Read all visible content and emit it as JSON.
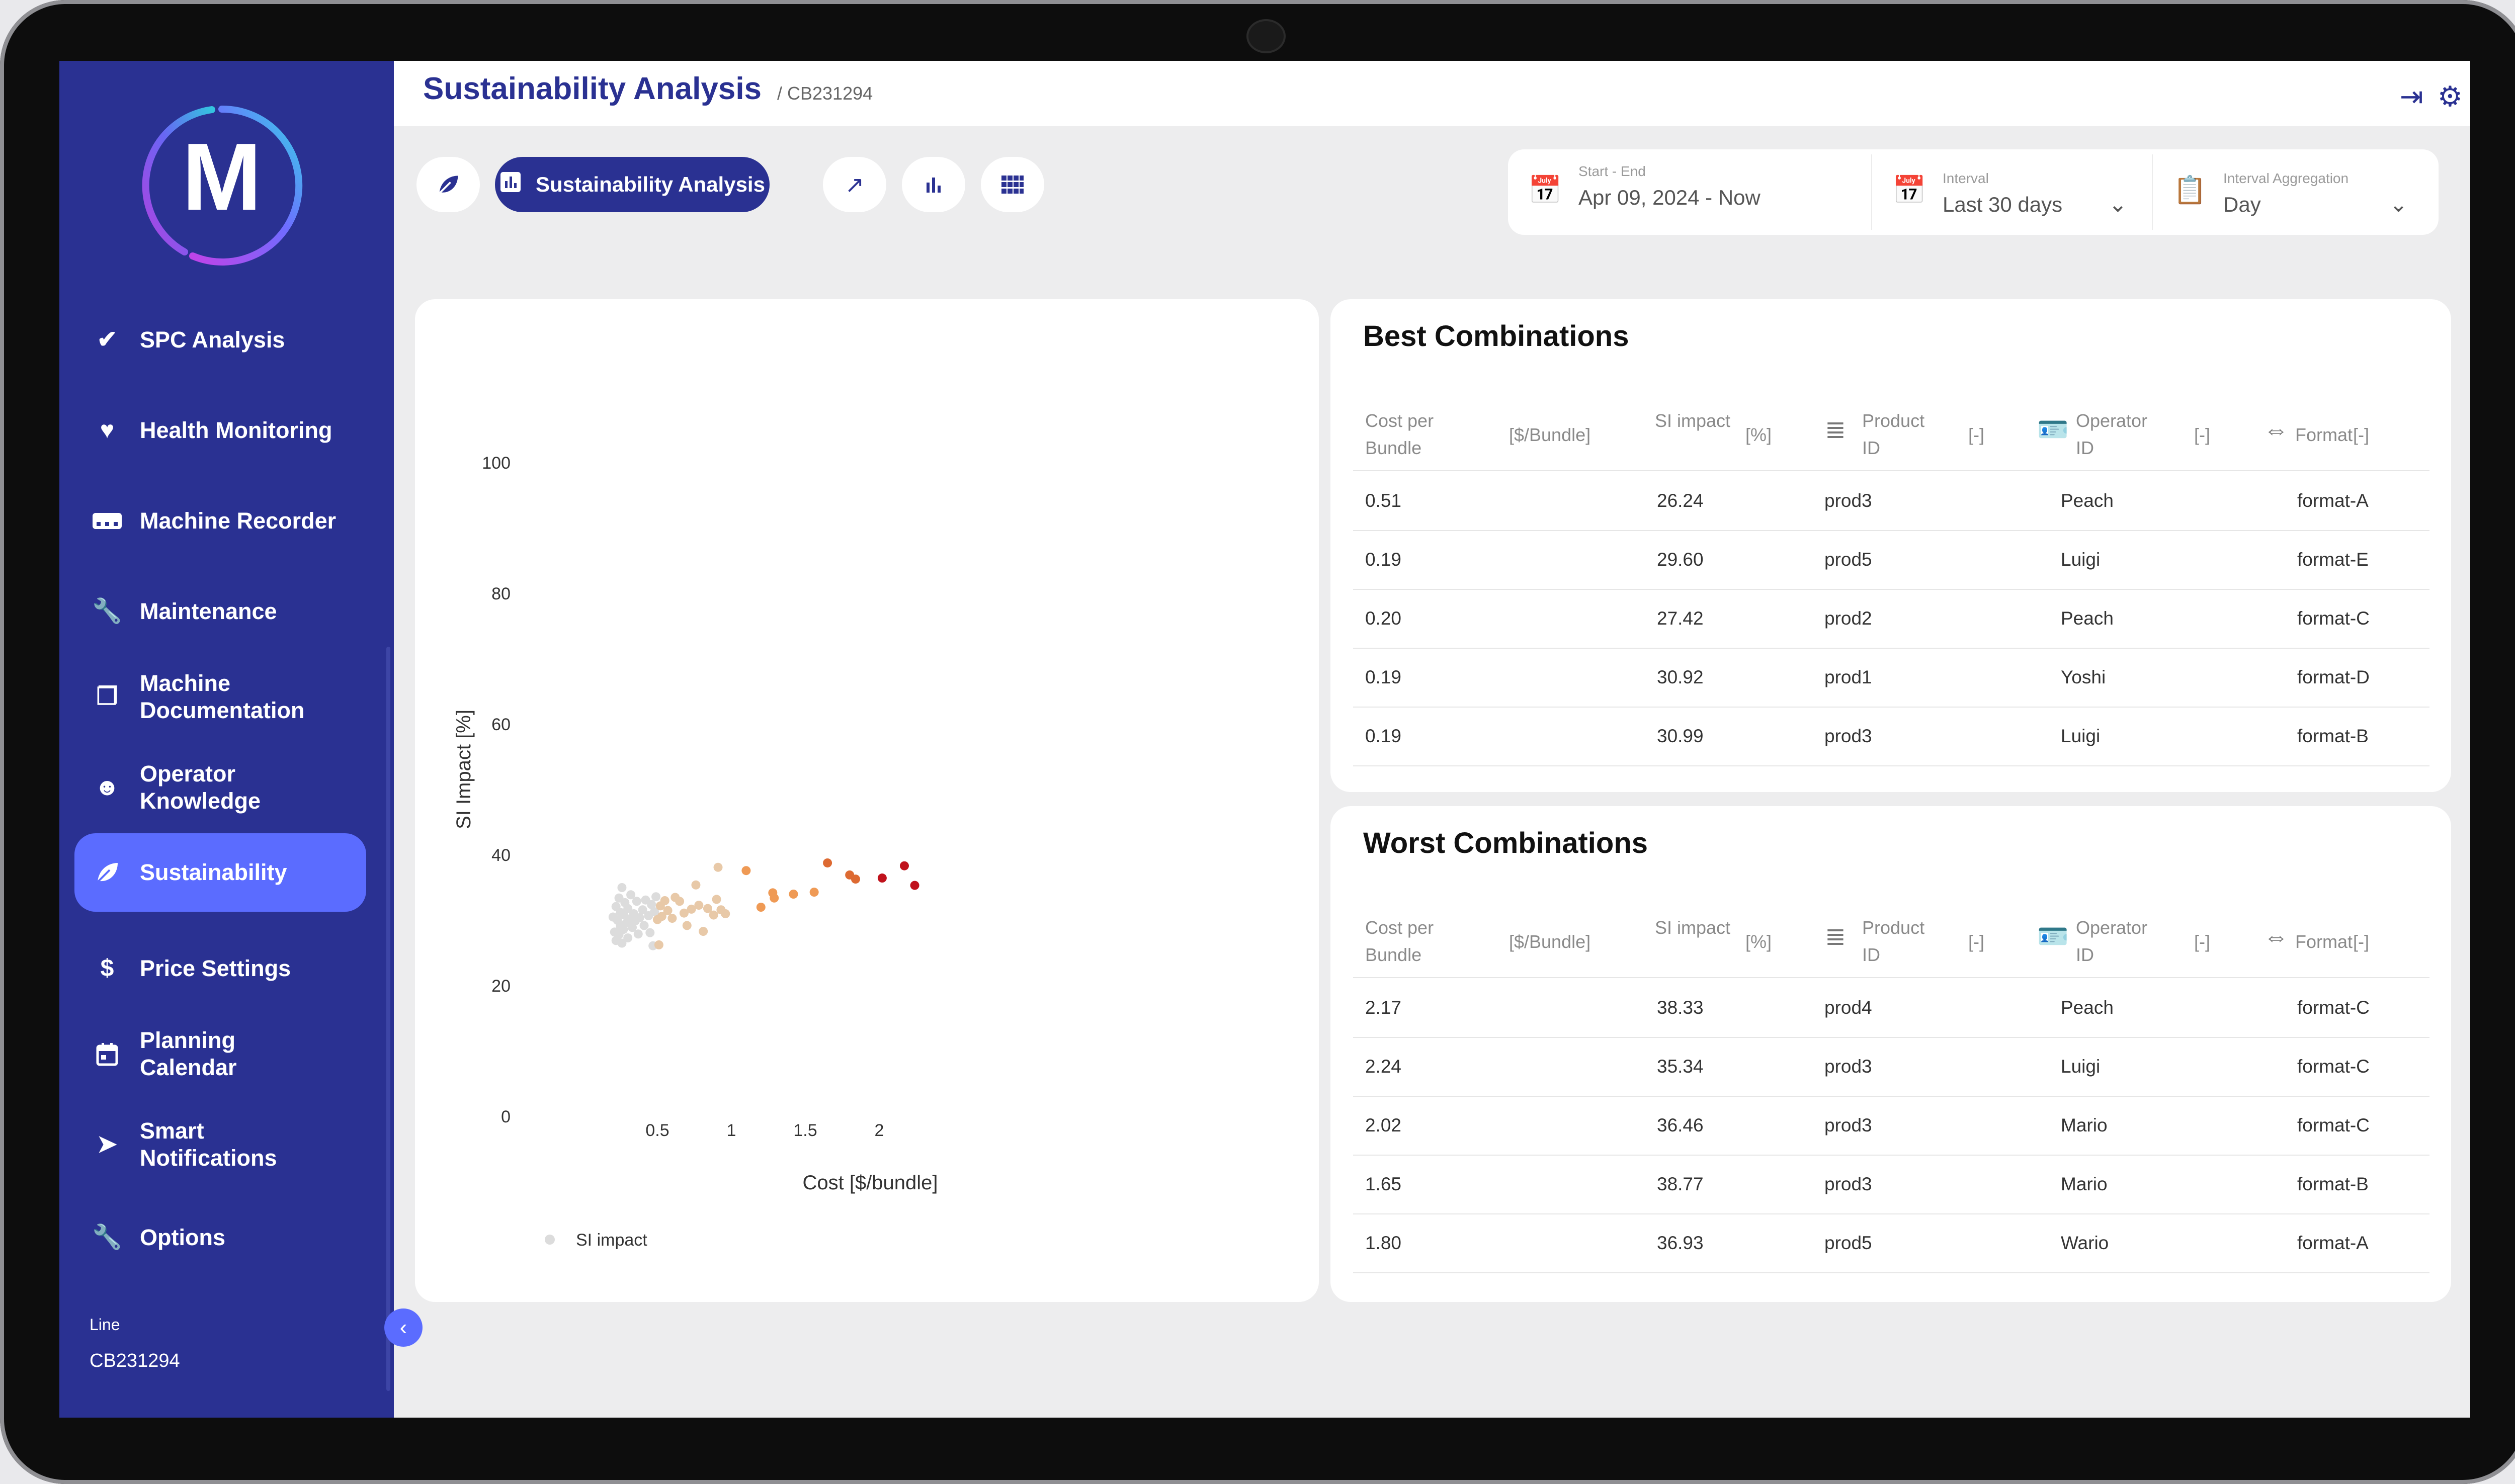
{
  "app": {
    "logo_letter": "M",
    "title": "Sustainability Analysis",
    "breadcrumb": "/ CB231294"
  },
  "colors": {
    "sidebar": "#2a3192",
    "accent": "#5b6cff",
    "primary": "#2a3192"
  },
  "sidebar": {
    "items": [
      {
        "label": "SPC Analysis",
        "icon": "double-check-icon"
      },
      {
        "label": "Health Monitoring",
        "icon": "heart-pulse-icon"
      },
      {
        "label": "Machine Recorder",
        "icon": "recorder-icon"
      },
      {
        "label": "Maintenance",
        "icon": "wrench-icon"
      },
      {
        "label": "Machine Documentation",
        "icon": "documents-icon"
      },
      {
        "label": "Operator Knowledge",
        "icon": "head-brain-icon"
      },
      {
        "label": "Sustainability",
        "icon": "leaf-icon"
      },
      {
        "label": "Price Settings",
        "icon": "dollar-icon"
      },
      {
        "label": "Planning Calendar",
        "icon": "calendar-icon"
      },
      {
        "label": "Smart Notifications",
        "icon": "send-icon"
      },
      {
        "label": "Options",
        "icon": "wrench-icon"
      }
    ],
    "active": "Sustainability",
    "line_label": "Line",
    "line_value": "CB231294"
  },
  "toolbar": {
    "active_label": "Sustainability Analysis"
  },
  "filters": {
    "range_label": "Start - End",
    "range_value": "Apr 09, 2024 - Now",
    "interval_label": "Interval",
    "interval_value": "Last 30 days",
    "aggregation_label": "Interval Aggregation",
    "aggregation_value": "Day"
  },
  "chart_data": {
    "type": "scatter",
    "xlabel": "Cost [$/bundle]",
    "ylabel": "SI Impact [%]",
    "xticks": [
      "0.5",
      "1",
      "1.5",
      "2"
    ],
    "yticks": [
      "0",
      "20",
      "40",
      "60",
      "80",
      "100"
    ],
    "xlim": [
      0.14,
      2.4
    ],
    "ylim": [
      0,
      100
    ],
    "legend": "SI impact",
    "legend_position": "bottom-left",
    "grid": false,
    "color_scale": [
      "#dcdcdc",
      "#e8c9a8",
      "#ef9a55",
      "#dd6a32",
      "#c0121c"
    ],
    "points": [
      {
        "x": 0.2,
        "y": 30.5
      },
      {
        "x": 0.21,
        "y": 28.2
      },
      {
        "x": 0.22,
        "y": 32.1
      },
      {
        "x": 0.22,
        "y": 26.9
      },
      {
        "x": 0.23,
        "y": 30.0
      },
      {
        "x": 0.24,
        "y": 33.4
      },
      {
        "x": 0.24,
        "y": 27.8
      },
      {
        "x": 0.25,
        "y": 31.2
      },
      {
        "x": 0.25,
        "y": 29.1
      },
      {
        "x": 0.26,
        "y": 35.0
      },
      {
        "x": 0.26,
        "y": 26.5
      },
      {
        "x": 0.27,
        "y": 30.9
      },
      {
        "x": 0.27,
        "y": 28.6
      },
      {
        "x": 0.28,
        "y": 32.7
      },
      {
        "x": 0.29,
        "y": 29.6
      },
      {
        "x": 0.3,
        "y": 27.3
      },
      {
        "x": 0.3,
        "y": 31.8
      },
      {
        "x": 0.31,
        "y": 30.2
      },
      {
        "x": 0.32,
        "y": 33.9
      },
      {
        "x": 0.33,
        "y": 28.9
      },
      {
        "x": 0.34,
        "y": 31.0
      },
      {
        "x": 0.35,
        "y": 29.9
      },
      {
        "x": 0.36,
        "y": 32.9
      },
      {
        "x": 0.37,
        "y": 27.9
      },
      {
        "x": 0.38,
        "y": 30.4
      },
      {
        "x": 0.4,
        "y": 31.6
      },
      {
        "x": 0.41,
        "y": 29.2
      },
      {
        "x": 0.42,
        "y": 33.1
      },
      {
        "x": 0.44,
        "y": 30.7
      },
      {
        "x": 0.45,
        "y": 28.1
      },
      {
        "x": 0.46,
        "y": 32.4
      },
      {
        "x": 0.47,
        "y": 26.1
      },
      {
        "x": 0.48,
        "y": 31.3
      },
      {
        "x": 0.49,
        "y": 33.6
      },
      {
        "x": 0.5,
        "y": 30.1
      },
      {
        "x": 0.51,
        "y": 26.24
      },
      {
        "x": 0.52,
        "y": 32.2
      },
      {
        "x": 0.53,
        "y": 30.6
      },
      {
        "x": 0.55,
        "y": 33.0
      },
      {
        "x": 0.57,
        "y": 31.5
      },
      {
        "x": 0.6,
        "y": 30.3
      },
      {
        "x": 0.62,
        "y": 33.5
      },
      {
        "x": 0.65,
        "y": 32.9
      },
      {
        "x": 0.68,
        "y": 31.1
      },
      {
        "x": 0.7,
        "y": 29.2
      },
      {
        "x": 0.73,
        "y": 31.7
      },
      {
        "x": 0.76,
        "y": 35.4
      },
      {
        "x": 0.78,
        "y": 32.3
      },
      {
        "x": 0.81,
        "y": 28.3
      },
      {
        "x": 0.84,
        "y": 31.8
      },
      {
        "x": 0.88,
        "y": 30.8
      },
      {
        "x": 0.9,
        "y": 33.2
      },
      {
        "x": 0.91,
        "y": 38.1
      },
      {
        "x": 0.93,
        "y": 31.6
      },
      {
        "x": 0.96,
        "y": 31.0
      },
      {
        "x": 1.1,
        "y": 37.6
      },
      {
        "x": 1.2,
        "y": 32.0
      },
      {
        "x": 1.28,
        "y": 34.2
      },
      {
        "x": 1.29,
        "y": 33.4
      },
      {
        "x": 1.42,
        "y": 34.0
      },
      {
        "x": 1.56,
        "y": 34.3
      },
      {
        "x": 1.65,
        "y": 38.77
      },
      {
        "x": 1.8,
        "y": 36.93
      },
      {
        "x": 1.84,
        "y": 36.3
      },
      {
        "x": 2.02,
        "y": 36.46
      },
      {
        "x": 2.17,
        "y": 38.33
      },
      {
        "x": 2.24,
        "y": 35.34
      }
    ]
  },
  "best": {
    "title": "Best Combinations",
    "headers": {
      "cost": "Cost per Bundle",
      "cost_unit": "[$/Bundle]",
      "si": "SI impact",
      "si_unit": "[%]",
      "product": "Product ID",
      "product_unit": "[-]",
      "operator": "Operator ID",
      "operator_unit": "[-]",
      "format": "Format",
      "format_unit": "[-]"
    },
    "rows": [
      [
        "0.51",
        "26.24",
        "prod3",
        "Peach",
        "format-A"
      ],
      [
        "0.19",
        "29.60",
        "prod5",
        "Luigi",
        "format-E"
      ],
      [
        "0.20",
        "27.42",
        "prod2",
        "Peach",
        "format-C"
      ],
      [
        "0.19",
        "30.92",
        "prod1",
        "Yoshi",
        "format-D"
      ],
      [
        "0.19",
        "30.99",
        "prod3",
        "Luigi",
        "format-B"
      ]
    ]
  },
  "worst": {
    "title": "Worst Combinations",
    "headers": {
      "cost": "Cost per Bundle",
      "cost_unit": "[$/Bundle]",
      "si": "SI impact",
      "si_unit": "[%]",
      "product": "Product ID",
      "product_unit": "[-]",
      "operator": "Operator ID",
      "operator_unit": "[-]",
      "format": "Format",
      "format_unit": "[-]"
    },
    "rows": [
      [
        "2.17",
        "38.33",
        "prod4",
        "Peach",
        "format-C"
      ],
      [
        "2.24",
        "35.34",
        "prod3",
        "Luigi",
        "format-C"
      ],
      [
        "2.02",
        "36.46",
        "prod3",
        "Mario",
        "format-C"
      ],
      [
        "1.65",
        "38.77",
        "prod3",
        "Mario",
        "format-B"
      ],
      [
        "1.80",
        "36.93",
        "prod5",
        "Wario",
        "format-A"
      ]
    ]
  }
}
